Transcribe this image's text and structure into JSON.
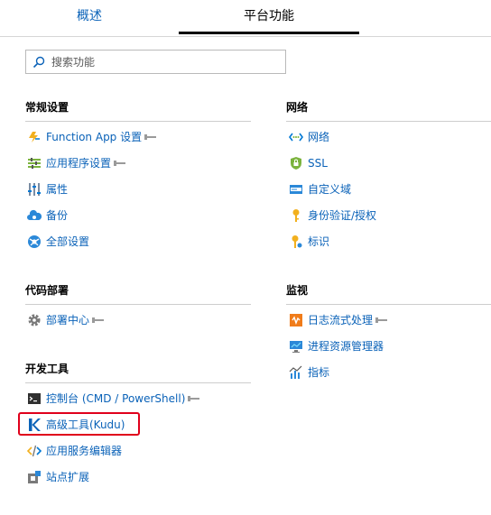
{
  "tabs": [
    {
      "label": "概述"
    },
    {
      "label": "平台功能",
      "active": true
    }
  ],
  "search": {
    "placeholder": "搜索功能",
    "value": ""
  },
  "sections": {
    "general": {
      "title": "常规设置",
      "items": [
        {
          "label": "Function App 设置",
          "icon": "lightning-icon",
          "pinned": true
        },
        {
          "label": "应用程序设置",
          "icon": "app-settings-icon",
          "pinned": true
        },
        {
          "label": "属性",
          "icon": "properties-icon"
        },
        {
          "label": "备份",
          "icon": "cloud-backup-icon"
        },
        {
          "label": "全部设置",
          "icon": "globe-settings-icon"
        }
      ]
    },
    "network": {
      "title": "网络",
      "items": [
        {
          "label": "网络",
          "icon": "network-icon"
        },
        {
          "label": "SSL",
          "icon": "ssl-shield-icon"
        },
        {
          "label": "自定义域",
          "icon": "custom-domain-icon"
        },
        {
          "label": "身份验证/授权",
          "icon": "key-icon"
        },
        {
          "label": "标识",
          "icon": "identity-icon"
        }
      ]
    },
    "deployment": {
      "title": "代码部署",
      "items": [
        {
          "label": "部署中心",
          "icon": "gear-icon",
          "pinned": true
        }
      ]
    },
    "monitoring": {
      "title": "监视",
      "items": [
        {
          "label": "日志流式处理",
          "icon": "log-stream-icon",
          "pinned": true
        },
        {
          "label": "进程资源管理器",
          "icon": "process-explorer-icon"
        },
        {
          "label": "指标",
          "icon": "metrics-icon"
        }
      ]
    },
    "devtools": {
      "title": "开发工具",
      "items": [
        {
          "label": "控制台 (CMD / PowerShell)",
          "icon": "console-icon",
          "pinned": true
        },
        {
          "label": "高级工具(Kudu)",
          "icon": "kudu-icon",
          "highlighted": true
        },
        {
          "label": "应用服务编辑器",
          "icon": "code-editor-icon"
        },
        {
          "label": "站点扩展",
          "icon": "extension-icon"
        }
      ]
    }
  },
  "colors": {
    "link": "#0a62b8",
    "highlight_border": "#e0001b",
    "divider": "#cdcdcd"
  }
}
